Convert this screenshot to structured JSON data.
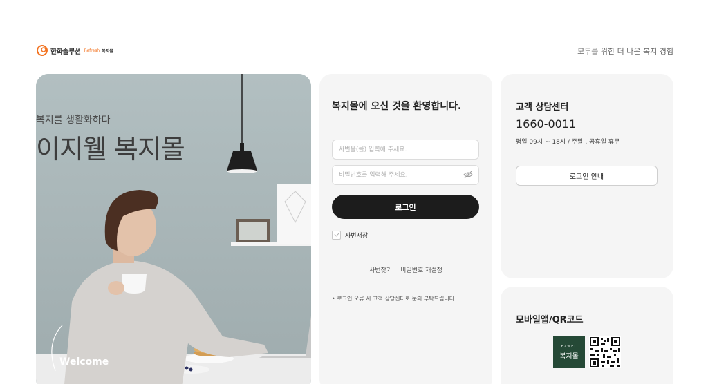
{
  "header": {
    "logo_main": "한화솔루션",
    "logo_sub": "Refresh",
    "logo_sub2": "복지몰",
    "tagline": "모두를 위한 더 나은 복지 경험"
  },
  "hero": {
    "subtitle": "복지를 생활화하다",
    "title": "이지웰 복지몰",
    "welcome": "Welcome"
  },
  "login": {
    "title": "복지몰에 오신 것을 환영합니다.",
    "id_placeholder": "사번을(를) 입력해 주세요.",
    "pw_placeholder": "비밀번호를 입력해 주세요.",
    "login_button": "로그인",
    "remember_label": "사번저장",
    "find_id": "사번찾기",
    "reset_pw": "비밀번호 재설정",
    "notice": "• 로그인 오류 시 고객 상담센터로 문의 부탁드립니다."
  },
  "customer_service": {
    "title": "고객 상담센터",
    "phone": "1660-0011",
    "hours": "평일 09시 ~ 18시 / 주말 , 공휴일 휴무",
    "guide_button": "로그인 안내"
  },
  "mobile": {
    "title": "모바일앱/QR코드",
    "app_brand": "EZWEL",
    "app_name": "복지몰"
  },
  "colors": {
    "accent": "#f37321",
    "button_dark": "#1c1c1c",
    "card_bg": "#f5f5f5",
    "app_icon_bg": "#254936"
  }
}
